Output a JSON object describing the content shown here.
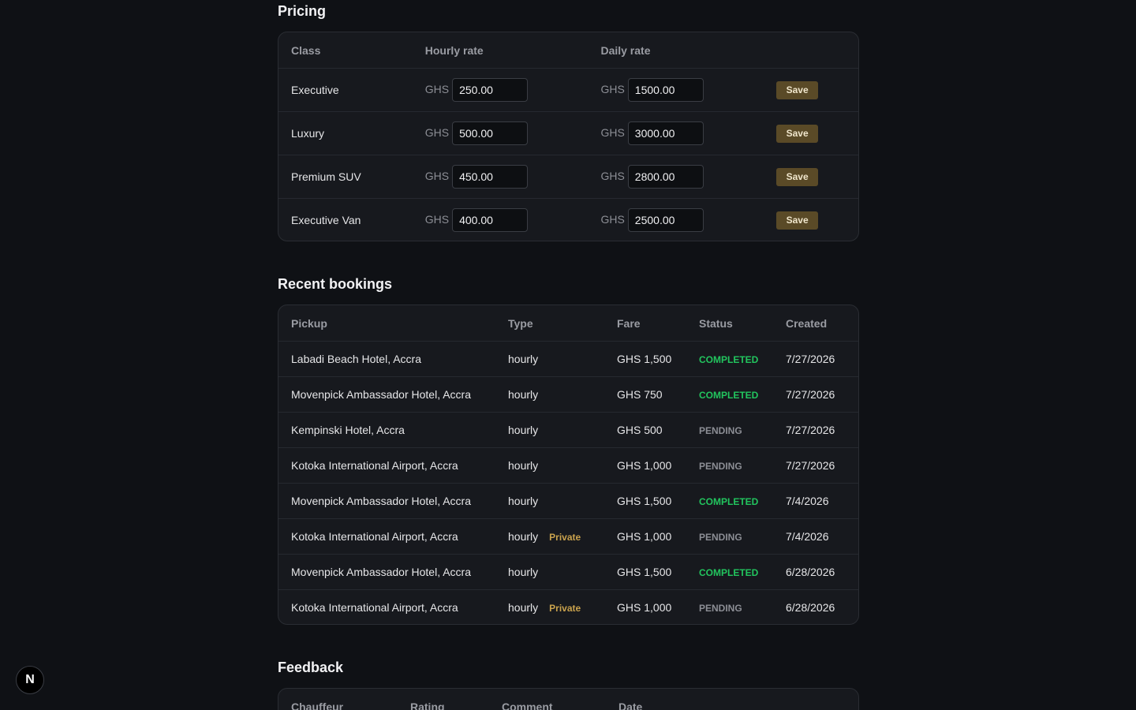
{
  "pricing": {
    "title": "Pricing",
    "headers": {
      "class": "Class",
      "hourly": "Hourly rate",
      "daily": "Daily rate"
    },
    "currency": "GHS",
    "save_label": "Save",
    "rows": [
      {
        "class": "Executive",
        "hourly": "250.00",
        "daily": "1500.00"
      },
      {
        "class": "Luxury",
        "hourly": "500.00",
        "daily": "3000.00"
      },
      {
        "class": "Premium SUV",
        "hourly": "450.00",
        "daily": "2800.00"
      },
      {
        "class": "Executive Van",
        "hourly": "400.00",
        "daily": "2500.00"
      }
    ]
  },
  "bookings": {
    "title": "Recent bookings",
    "headers": {
      "pickup": "Pickup",
      "type": "Type",
      "fare": "Fare",
      "status": "Status",
      "created": "Created"
    },
    "rows": [
      {
        "pickup": "Labadi Beach Hotel, Accra",
        "type": "hourly",
        "tag": "",
        "fare": "GHS 1,500",
        "status": "COMPLETED",
        "created": "7/27/2026"
      },
      {
        "pickup": "Movenpick Ambassador Hotel, Accra",
        "type": "hourly",
        "tag": "",
        "fare": "GHS 750",
        "status": "COMPLETED",
        "created": "7/27/2026"
      },
      {
        "pickup": "Kempinski Hotel, Accra",
        "type": "hourly",
        "tag": "",
        "fare": "GHS 500",
        "status": "PENDING",
        "created": "7/27/2026"
      },
      {
        "pickup": "Kotoka International Airport, Accra",
        "type": "hourly",
        "tag": "",
        "fare": "GHS 1,000",
        "status": "PENDING",
        "created": "7/27/2026"
      },
      {
        "pickup": "Movenpick Ambassador Hotel, Accra",
        "type": "hourly",
        "tag": "",
        "fare": "GHS 1,500",
        "status": "COMPLETED",
        "created": "7/4/2026"
      },
      {
        "pickup": "Kotoka International Airport, Accra",
        "type": "hourly",
        "tag": "Private",
        "fare": "GHS 1,000",
        "status": "PENDING",
        "created": "7/4/2026"
      },
      {
        "pickup": "Movenpick Ambassador Hotel, Accra",
        "type": "hourly",
        "tag": "",
        "fare": "GHS 1,500",
        "status": "COMPLETED",
        "created": "6/28/2026"
      },
      {
        "pickup": "Kotoka International Airport, Accra",
        "type": "hourly",
        "tag": "Private",
        "fare": "GHS 1,000",
        "status": "PENDING",
        "created": "6/28/2026"
      }
    ]
  },
  "feedback": {
    "title": "Feedback",
    "headers": {
      "chauffeur": "Chauffeur",
      "rating": "Rating",
      "comment": "Comment",
      "date": "Date"
    }
  },
  "badge": {
    "letter": "N",
    "icon": "nextjs-logo-icon"
  },
  "colors": {
    "background": "#0f1115",
    "card": "#17191e",
    "completed": "#22c55e",
    "pending": "#8c8e95",
    "private_tag": "#c9a24d",
    "save_button": "#5a4a27"
  }
}
